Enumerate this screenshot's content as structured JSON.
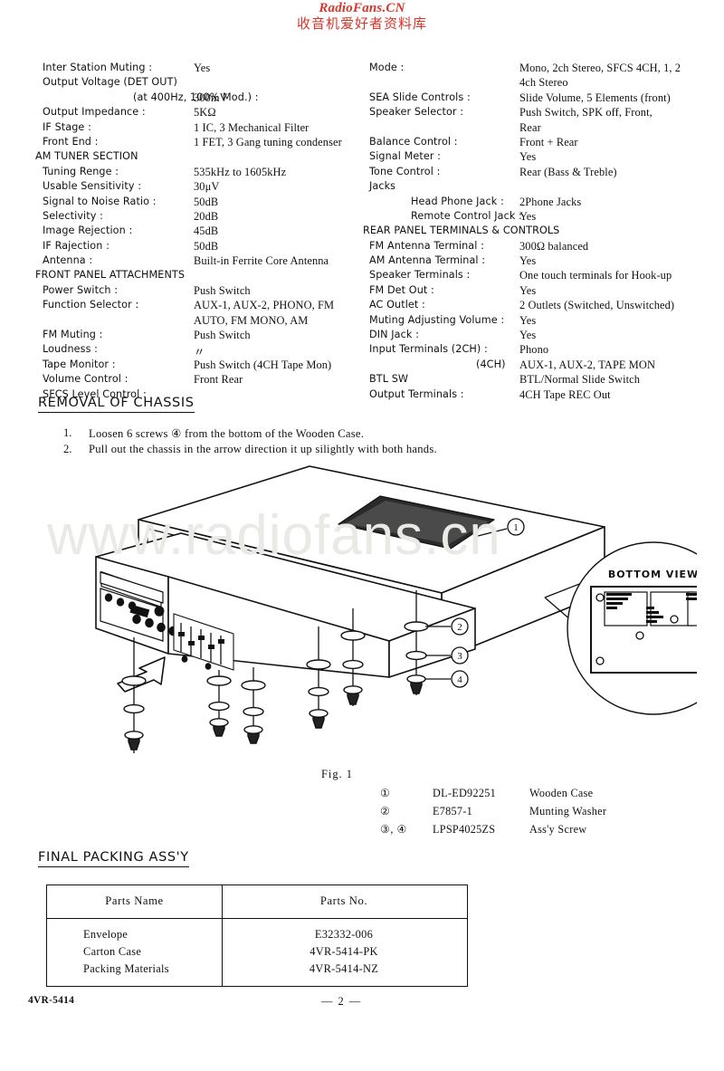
{
  "watermark": {
    "top_en": "RadioFans.CN",
    "top_cn": "收音机爱好者资料库",
    "top_color": "#d8352b",
    "figure_text": "www.radiofans.cn"
  },
  "specs": {
    "left_column": [
      {
        "kind": "item",
        "label": "Inter Station Muting :",
        "value": "Yes"
      },
      {
        "kind": "item",
        "label": "Output Voltage (DET OUT)",
        "value": ""
      },
      {
        "kind": "cont",
        "label": "(at 400Hz, 100% Mod.) :",
        "value": "300mV"
      },
      {
        "kind": "item",
        "label": "Output Impedance :",
        "value": "5KΩ"
      },
      {
        "kind": "item",
        "label": "IF Stage :",
        "value": "1 IC, 3 Mechanical Filter"
      },
      {
        "kind": "item",
        "label": "Front End :",
        "value": "1 FET, 3 Gang tuning condenser"
      },
      {
        "kind": "section",
        "label": "AM TUNER SECTION",
        "value": ""
      },
      {
        "kind": "item",
        "label": "Tuning Renge :",
        "value": "535kHz to 1605kHz"
      },
      {
        "kind": "item",
        "label": "Usable Sensitivity :",
        "value": "30μV"
      },
      {
        "kind": "item",
        "label": "Signal to Noise Ratio :",
        "value": "50dB"
      },
      {
        "kind": "item",
        "label": "Selectivity :",
        "value": "20dB"
      },
      {
        "kind": "item",
        "label": "Image Rejection :",
        "value": "45dB"
      },
      {
        "kind": "item",
        "label": "IF Rajection :",
        "value": "50dB"
      },
      {
        "kind": "item",
        "label": "Antenna :",
        "value": "Built-in Ferrite Core Antenna"
      },
      {
        "kind": "section",
        "label": "FRONT PANEL ATTACHMENTS",
        "value": ""
      },
      {
        "kind": "item",
        "label": "Power Switch :",
        "value": "Push Switch"
      },
      {
        "kind": "item",
        "label": "Function Selector :",
        "value": "AUX-1, AUX-2, PHONO, FM"
      },
      {
        "kind": "valonly",
        "label": "",
        "value": "AUTO, FM MONO, AM"
      },
      {
        "kind": "item",
        "label": "FM Muting :",
        "value": "Push Switch"
      },
      {
        "kind": "item",
        "label": "Loudness :",
        "value": "〃"
      },
      {
        "kind": "item",
        "label": "Tape Monitor :",
        "value": "Push Switch (4CH Tape Mon)"
      },
      {
        "kind": "item",
        "label": "Volume Control :",
        "value": "Front Rear"
      },
      {
        "kind": "item",
        "label": "SFCS Level Control :",
        "value": ""
      }
    ],
    "right_column": [
      {
        "kind": "item",
        "label": "Mode :",
        "value": "Mono, 2ch Stereo, SFCS 4CH, 1, 2"
      },
      {
        "kind": "valonly",
        "label": "",
        "value": "4ch Stereo"
      },
      {
        "kind": "item",
        "label": "SEA Slide Controls :",
        "value": "Slide Volume, 5 Elements (front)"
      },
      {
        "kind": "item",
        "label": "Speaker Selector :",
        "value": "Push Switch, SPK off, Front,"
      },
      {
        "kind": "valonly",
        "label": "",
        "value": "Rear"
      },
      {
        "kind": "item",
        "label": "Balance Control :",
        "value": "Front + Rear"
      },
      {
        "kind": "item",
        "label": "Signal Meter :",
        "value": "Yes"
      },
      {
        "kind": "item",
        "label": "Tone Control :",
        "value": "Rear (Bass & Treble)"
      },
      {
        "kind": "item",
        "label": "Jacks",
        "value": ""
      },
      {
        "kind": "sub",
        "label": "Head Phone Jack :",
        "value": "2Phone Jacks"
      },
      {
        "kind": "sub",
        "label": "Remote Control Jack :",
        "value": "Yes"
      },
      {
        "kind": "section",
        "label": "REAR PANEL TERMINALS & CONTROLS",
        "value": ""
      },
      {
        "kind": "item",
        "label": "FM Antenna Terminal :",
        "value": "300Ω balanced"
      },
      {
        "kind": "item",
        "label": "AM Antenna Terminal :",
        "value": "Yes"
      },
      {
        "kind": "item",
        "label": "Speaker Terminals :",
        "value": "One touch terminals for Hook-up"
      },
      {
        "kind": "item",
        "label": "FM Det Out :",
        "value": "Yes"
      },
      {
        "kind": "item",
        "label": "AC Outlet :",
        "value": "2 Outlets (Switched, Unswitched)"
      },
      {
        "kind": "item",
        "label": "Muting Adjusting Volume :",
        "value": "Yes"
      },
      {
        "kind": "item",
        "label": "DIN Jack :",
        "value": "Yes"
      },
      {
        "kind": "item",
        "label": "Input Terminals (2CH) :",
        "value": "Phono"
      },
      {
        "kind": "cont2",
        "label": "(4CH)",
        "value": "AUX-1, AUX-2, TAPE MON"
      },
      {
        "kind": "item",
        "label": "BTL SW",
        "value": "BTL/Normal Slide Switch"
      },
      {
        "kind": "item",
        "label": "Output Terminals :",
        "value": "4CH Tape REC Out"
      }
    ]
  },
  "removal": {
    "heading": "REMOVAL OF CHASSIS",
    "steps": [
      {
        "num": "1.",
        "text": "Loosen 6 screws ④ from the bottom of the Wooden Case."
      },
      {
        "num": "2.",
        "text": "Pull out the chassis in the arrow direction it up silightly with both hands."
      }
    ]
  },
  "figure": {
    "caption": "Fig.  1",
    "inset_label": "BOTTOM   VIEW",
    "callouts": [
      "1",
      "2",
      "3",
      "4"
    ],
    "legend": [
      {
        "mark": "①",
        "part_no": "DL-ED92251",
        "part_name": "Wooden Case"
      },
      {
        "mark": "②",
        "part_no": "E7857-1",
        "part_name": "Munting Washer"
      },
      {
        "mark": "③, ④",
        "part_no": "LPSP4025ZS",
        "part_name": "Ass'y Screw"
      }
    ]
  },
  "packing": {
    "heading": "FINAL PACKING ASS'Y",
    "columns": [
      "Parts Name",
      "Parts No."
    ],
    "rows": [
      {
        "name": "Envelope",
        "no": "E32332-006"
      },
      {
        "name": "Carton Case",
        "no": "4VR-5414-PK"
      },
      {
        "name": "Packing Materials",
        "no": "4VR-5414-NZ"
      }
    ]
  },
  "footer": {
    "model": "4VR-5414",
    "page": "— 2 —"
  }
}
